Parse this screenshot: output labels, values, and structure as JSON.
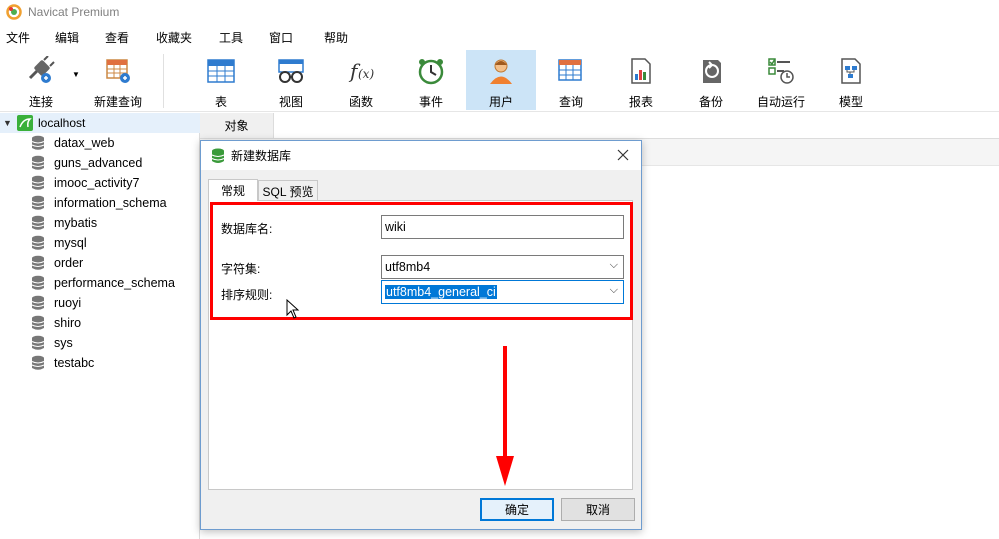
{
  "app": {
    "title": "Navicat Premium"
  },
  "menu": [
    "文件",
    "编辑",
    "查看",
    "收藏夹",
    "工具",
    "窗口",
    "帮助"
  ],
  "toolbar": {
    "connect": "连接",
    "new_query": "新建查询",
    "items": [
      "表",
      "视图",
      "函数",
      "事件",
      "用户",
      "查询",
      "报表",
      "备份",
      "自动运行",
      "模型"
    ],
    "active": "用户"
  },
  "sidebar": {
    "connection": "localhost",
    "databases": [
      "datax_web",
      "guns_advanced",
      "imooc_activity7",
      "information_schema",
      "mybatis",
      "mysql",
      "order",
      "performance_schema",
      "ruoyi",
      "shiro",
      "sys",
      "testabc"
    ]
  },
  "main": {
    "object_tab": "对象"
  },
  "dialog": {
    "title": "新建数据库",
    "tabs": [
      "常规",
      "SQL 预览"
    ],
    "db_name_label": "数据库名:",
    "db_name_value": "wiki",
    "charset_label": "字符集:",
    "charset_value": "utf8mb4",
    "collation_label": "排序规则:",
    "collation_value": "utf8mb4_general_ci",
    "ok": "确定",
    "cancel": "取消"
  },
  "colors": {
    "annotation": "#ff0000",
    "accent": "#0078d7",
    "active_tool": "#cce4f7"
  }
}
